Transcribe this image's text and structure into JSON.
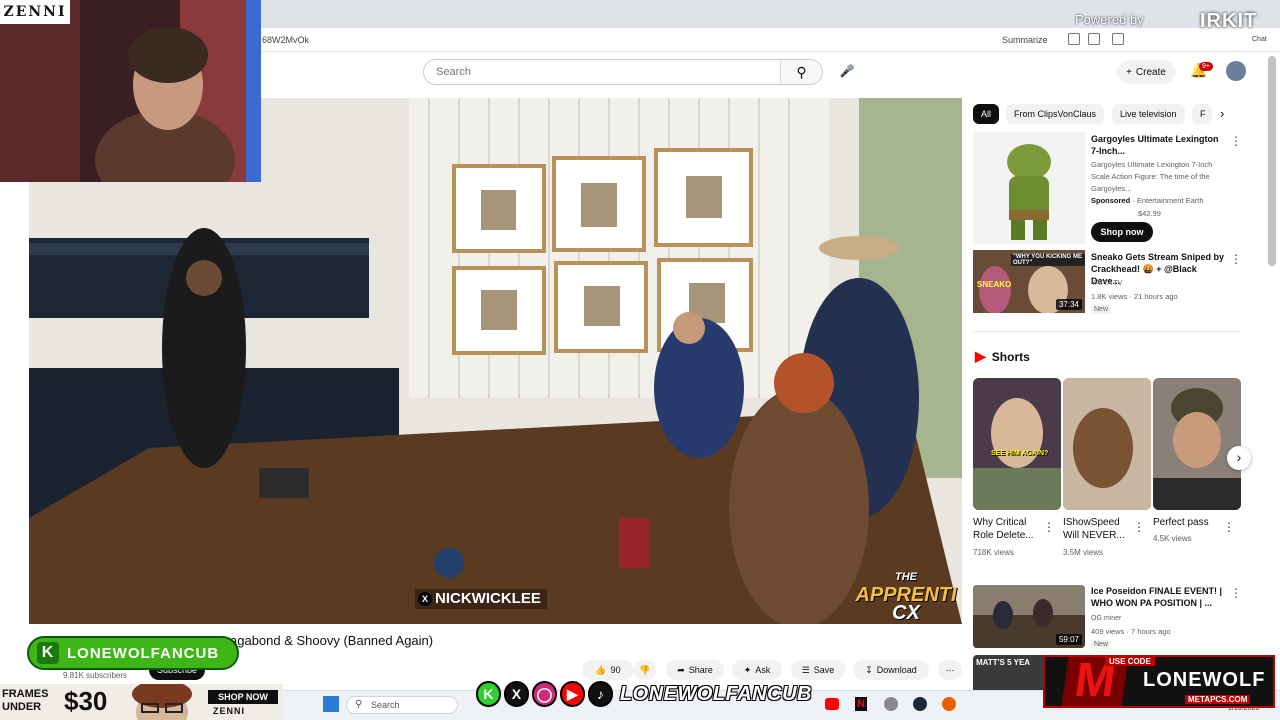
{
  "browser": {
    "url_fragment": "68W2MvOk",
    "summarize_label": "Summarize",
    "chat_label": "Chat"
  },
  "header": {
    "search_placeholder": "Search",
    "create_label": "Create",
    "notifications_badge": "9+"
  },
  "webcam": {
    "brand": "ZENNI"
  },
  "stream_watermark": {
    "powered_by": "Powered by",
    "brand": "IRKIT"
  },
  "video": {
    "caption": "NICKWICKLEE",
    "show_logo_line1": "THE",
    "show_logo_line2": "APPRENTI",
    "show_logo_line3": "CX",
    "title_visible": "agabond & Shoovy (Banned Again)",
    "subscribers": "9.81K subscribers",
    "subscribe_label": "Subscribe",
    "like_count": "90",
    "share_label": "Share",
    "ask_label": "Ask",
    "save_label": "Save",
    "download_label": "Download"
  },
  "channel_badge": {
    "letter": "K",
    "name": "LONEWOLFANCUB"
  },
  "sidebar": {
    "chips": [
      "All",
      "From ClipsVonClaus",
      "Live television",
      "F"
    ],
    "ad": {
      "title": "Gargoyles Ultimate Lexington 7-Inch...",
      "description": "Gargoyles Ultimate Lexington 7-Inch Scale Action Figure: The time of the Gargoyles...",
      "sponsored": "Sponsored",
      "advertiser": "Entertainment Earth",
      "price": "$42.99",
      "cta": "Shop now"
    },
    "videos": [
      {
        "title": "Sneako Gets Stream Sniped by Crackhead! 🤬 + @Black Dave...",
        "channel": "YATTA TV",
        "meta": "1.8K views · 21 hours ago",
        "badge": "New",
        "duration": "37:34",
        "thumb_text": "\"WHY YOU KICKING ME OUT?\"",
        "thumb_text2": "SNEAKO"
      },
      {
        "title": "Ice Poseidon FINALE EVENT! | WHO WON PA POSITION | ...",
        "channel": "OG miner",
        "meta": "409 views · 7 hours ago",
        "badge": "New",
        "duration": "59:07"
      },
      {
        "thumb_text": "MATT'S 5 YEA"
      }
    ],
    "shorts_heading": "Shorts",
    "shorts": [
      {
        "title": "Why Critical Role Delete...",
        "views": "718K views",
        "thumb_text": "SEE HIM AGAIN?"
      },
      {
        "title": "IShowSpeed Will NEVER...",
        "views": "3.5M views"
      },
      {
        "title": "Perfect pass",
        "views": "4.5K views"
      }
    ]
  },
  "taskbar": {
    "search_label": "Search",
    "date": "1/10/2026"
  },
  "overlays": {
    "frames_line1": "FRAMES",
    "frames_line2": "UNDER",
    "frames_price": "$30",
    "shop_now": "SHOP NOW",
    "zenni_small": "ZENNI",
    "social_handle": "LONEWOLFANCUB",
    "metapcs_code_label": "USE CODE",
    "metapcs_code": "LONEWOLF",
    "metapcs_site": "METAPCS.COM",
    "metapcs_letter": "M"
  },
  "colors": {
    "youtube_red": "#ff0000",
    "badge_green": "#3fb618",
    "metapcs_red": "#b00000"
  }
}
